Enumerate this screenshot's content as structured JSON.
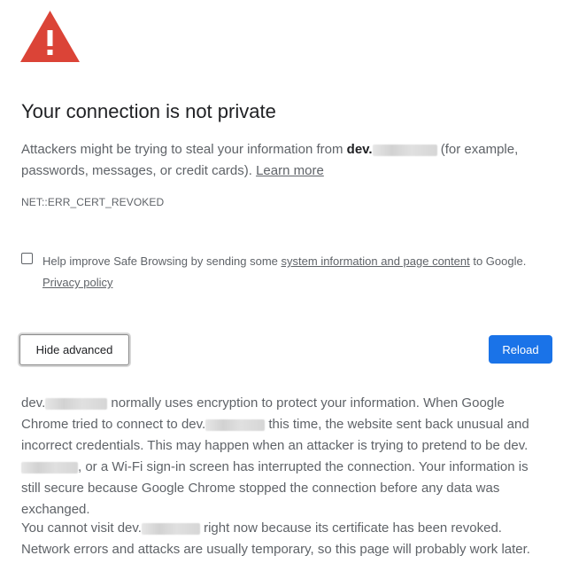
{
  "heading": "Your connection is not private",
  "intro": {
    "before_domain": "Attackers might be trying to steal your information from ",
    "domain_visible": "dev.",
    "after_domain": " (for example, passwords, messages, or credit cards). ",
    "learn_more": "Learn more"
  },
  "error_code": "NET::ERR_CERT_REVOKED",
  "safe_browsing": {
    "before_link": "Help improve Safe Browsing by sending some ",
    "link": "system information and page content",
    "after_link": " to Google.",
    "privacy_policy": "Privacy policy",
    "checked": false
  },
  "buttons": {
    "hide_advanced": "Hide advanced",
    "reload": "Reload"
  },
  "details": {
    "d1": "dev.",
    "t1": " normally uses encryption to protect your information. When Google Chrome tried to connect to ",
    "d2": "dev.",
    "t2": " this time, the website sent back unusual and incorrect credentials. This may happen when an attacker is trying to pretend to be ",
    "d3": "dev.",
    "t3": ", or a Wi-Fi sign-in screen has interrupted the connection. Your information is still secure because Google Chrome stopped the connection before any data was exchanged."
  },
  "revoked": {
    "before": "You cannot visit ",
    "domain": "dev.",
    "after": " right now because its certificate has been revoked. Network errors and attacks are usually temporary, so this page will probably work later."
  },
  "colors": {
    "warning_red": "#db4437",
    "primary_blue": "#1a73e8",
    "text_gray": "#5f6368",
    "heading_dark": "#202124"
  },
  "icons": {
    "warning": "warning-triangle-icon"
  }
}
